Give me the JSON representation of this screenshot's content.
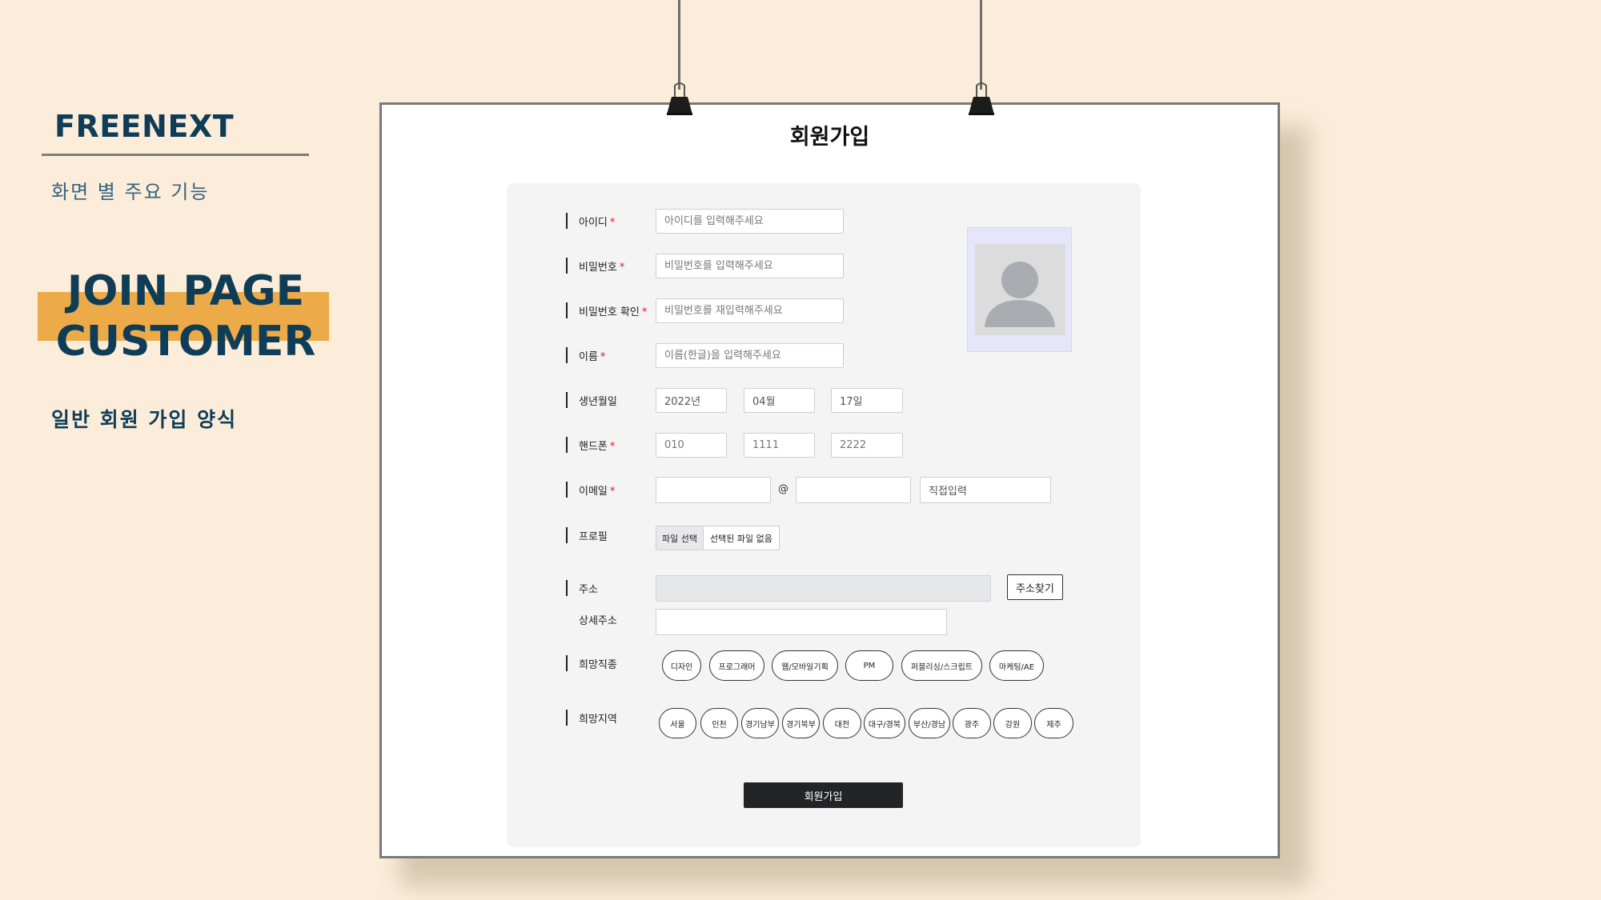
{
  "left": {
    "brand": "FREENEXT",
    "subtitle": "화면 별 주요 기능",
    "hero_line1": "JOIN PAGE",
    "hero_line2": "CUSTOMER",
    "description": "일반 회원 가입 양식",
    "accent_color": "#ecab48",
    "text_color": "#0f3d57"
  },
  "form": {
    "title": "회원가입",
    "id": {
      "label": "아이디",
      "required": "*",
      "placeholder": "아이디를 입력해주세요"
    },
    "password": {
      "label": "비밀번호",
      "required": "*",
      "placeholder": "비밀번호를 입력해주세요"
    },
    "password_confirm": {
      "label": "비밀번호 확인",
      "required": "*",
      "placeholder": "비밀번호를 재입력해주세요"
    },
    "name": {
      "label": "이름",
      "required": "*",
      "placeholder": "이름(한글)을 입력해주세요"
    },
    "birth": {
      "label": "생년월일",
      "year": "2022년",
      "month": "04월",
      "day": "17일"
    },
    "phone": {
      "label": "핸드폰",
      "required": "*",
      "part1": "010",
      "part2": "1111",
      "part3": "2222"
    },
    "email": {
      "label": "이메일",
      "required": "*",
      "at": "@",
      "domain_select": "직접입력"
    },
    "profile": {
      "label": "프로필",
      "file_button": "파일 선택",
      "file_status": "선택된 파일 없음",
      "avatar_icon": "user-silhouette-icon"
    },
    "address": {
      "label": "주소",
      "search_button": "주소찾기",
      "detail_label": "상세주소"
    },
    "jobs": {
      "label": "희망직종",
      "options": [
        "디자인",
        "프로그래머",
        "웹/모바일기획",
        "PM",
        "퍼블리싱/스크립트",
        "마케팅/AE"
      ]
    },
    "regions": {
      "label": "희망지역",
      "options": [
        "서울",
        "인천",
        "경기남부",
        "경기북부",
        "대전",
        "대구/경북",
        "부산/경남",
        "광주",
        "강원",
        "제주"
      ]
    },
    "submit": "회원가입"
  }
}
